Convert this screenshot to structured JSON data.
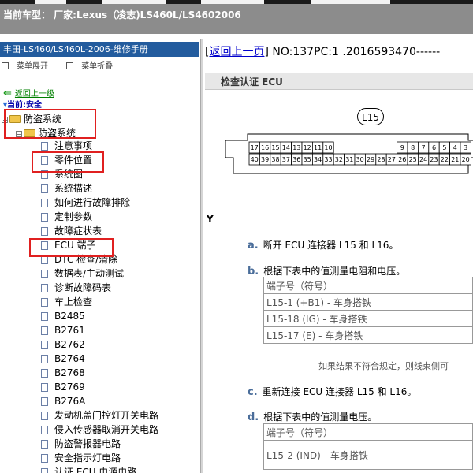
{
  "window": {
    "title": "当前车型： 厂家:Lexus（凌志)LS460L/LS4602006"
  },
  "left_pane": {
    "manual_title": "丰田-LS460/LS460L-2006-维修手册",
    "toolbar": {
      "expand": "菜单展开",
      "collapse": "菜单折叠"
    },
    "go_back": "返回上一级",
    "current": "当前:安全",
    "tree": {
      "level1": "防盗系统",
      "level2": "防盗系统",
      "items": [
        "注意事项",
        "零件位置",
        "系统图",
        "系统描述",
        "如何进行故障排除",
        "定制参数",
        "故障症状表",
        "ECU 端子",
        "DTC 检查/清除",
        "数据表/主动测试",
        "诊断故障码表",
        "车上检查",
        "B2485",
        "B2761",
        "B2762",
        "B2764",
        "B2768",
        "B2769",
        "B276A",
        "发动机盖门控灯开关电路",
        "侵入传感器取消开关电路",
        "防盗警报器电路",
        "安全指示灯电路",
        "认证 ECU 电源电路"
      ],
      "highlight_colors": {
        "box": "#e02020"
      }
    }
  },
  "right_pane": {
    "back_link": "返回上一页",
    "doc_number": " NO:137PC:1 .2016593470------",
    "section_title": "检查认证 ECU",
    "connector": {
      "label": "L15",
      "row1": [
        "17",
        "16",
        "15",
        "14",
        "13",
        "12",
        "11",
        "10",
        "",
        "",
        "",
        "",
        "",
        "",
        "9",
        "8",
        "7",
        "6",
        "5",
        "4",
        "3"
      ],
      "row2": [
        "40",
        "39",
        "38",
        "37",
        "36",
        "35",
        "34",
        "33",
        "32",
        "31",
        "30",
        "29",
        "28",
        "27",
        "26",
        "25",
        "24",
        "23",
        "22",
        "21",
        "20"
      ]
    },
    "y_label": "Y",
    "step_a": {
      "letter": "a.",
      "text": "断开 ECU 连接器 L15 和 L16。"
    },
    "step_b": {
      "letter": "b.",
      "text": "根据下表中的值测量电阻和电压。"
    },
    "table_b": [
      "端子号（符号）",
      "L15-1 (+B1) - 车身搭铁",
      "L15-18 (IG) - 车身搭铁",
      "L15-17 (E) - 车身搭铁"
    ],
    "note": "如果结果不符合规定，则线束侧可",
    "step_c": {
      "letter": "c.",
      "text": "重新连接 ECU 连接器 L15 和 L16。"
    },
    "step_d": {
      "letter": "d.",
      "text": "根据下表中的值测量电压。"
    },
    "table_d": [
      "端子号（符号）",
      "L15-2 (IND) - 车身搭铁"
    ]
  }
}
